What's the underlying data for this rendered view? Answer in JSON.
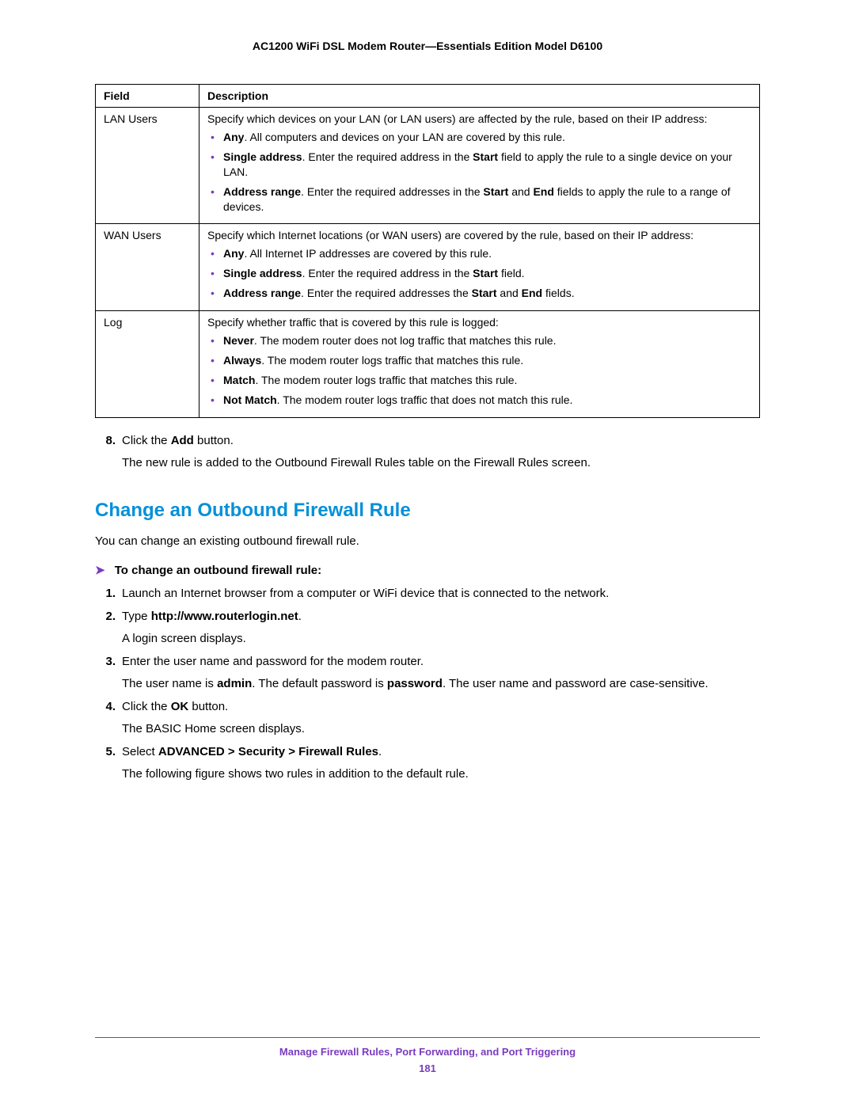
{
  "doc_title": "AC1200 WiFi DSL Modem Router—Essentials Edition Model D6100",
  "table": {
    "headers": [
      "Field",
      "Description"
    ],
    "rows": [
      {
        "field": "LAN Users",
        "intro": "Specify which devices on your LAN (or LAN users) are affected by the rule, based on their IP address:",
        "bullets": [
          {
            "lead": "Any",
            "rest": ". All computers and devices on your LAN are covered by this rule."
          },
          {
            "lead": "Single address",
            "rest_a": ". Enter the required address in the ",
            "b1": "Start",
            "rest_b": " field to apply the rule to a single device on your LAN."
          },
          {
            "lead": "Address range",
            "rest_a": ". Enter the required addresses in the ",
            "b1": "Start",
            "mid": " and ",
            "b2": "End",
            "rest_b": " fields to apply the rule to a range of devices."
          }
        ]
      },
      {
        "field": "WAN Users",
        "intro": "Specify which Internet locations (or WAN users) are covered by the rule, based on their IP address:",
        "bullets": [
          {
            "lead": "Any",
            "rest": ". All Internet IP addresses are covered by this rule."
          },
          {
            "lead": "Single address",
            "rest_a": ". Enter the required address in the ",
            "b1": "Start",
            "rest_b": " field."
          },
          {
            "lead": "Address range",
            "rest_a": ". Enter the required addresses the ",
            "b1": "Start",
            "mid": " and ",
            "b2": "End",
            "rest_b": " fields."
          }
        ]
      },
      {
        "field": "Log",
        "intro": "Specify whether traffic that is covered by this rule is logged:",
        "bullets": [
          {
            "lead": "Never",
            "rest": ". The modem router does not log traffic that matches this rule."
          },
          {
            "lead": "Always",
            "rest": ". The modem router logs traffic that matches this rule."
          },
          {
            "lead": "Match",
            "rest": ". The modem router logs traffic that matches this rule."
          },
          {
            "lead": "Not Match",
            "rest": ". The modem router logs traffic that does not match this rule."
          }
        ]
      }
    ]
  },
  "step8": {
    "num": "8.",
    "pre": "Click the ",
    "bold": "Add",
    "post": " button.",
    "follow": "The new rule is added to the Outbound Firewall Rules table on the Firewall Rules screen."
  },
  "section_heading": "Change an Outbound Firewall Rule",
  "section_intro": "You can change an existing outbound firewall rule.",
  "procedure_title": "To change an outbound firewall rule:",
  "steps": [
    {
      "num": "1.",
      "text": "Launch an Internet browser from a computer or WiFi device that is connected to the network."
    },
    {
      "num": "2.",
      "pre": "Type ",
      "bold": "http://www.routerlogin.net",
      "post": ".",
      "follow": "A login screen displays."
    },
    {
      "num": "3.",
      "text": "Enter the user name and password for the modem router.",
      "follow_pre": "The user name is ",
      "follow_b1": "admin",
      "follow_mid": ". The default password is ",
      "follow_b2": "password",
      "follow_post": ". The user name and password are case-sensitive."
    },
    {
      "num": "4.",
      "pre": "Click the ",
      "bold": "OK",
      "post": " button.",
      "follow": "The BASIC Home screen displays."
    },
    {
      "num": "5.",
      "pre": "Select ",
      "bold": "ADVANCED > Security > Firewall Rules",
      "post": ".",
      "follow": "The following figure shows two rules in addition to the default rule."
    }
  ],
  "footer": {
    "text": "Manage Firewall Rules, Port Forwarding, and Port Triggering",
    "page": "181"
  }
}
